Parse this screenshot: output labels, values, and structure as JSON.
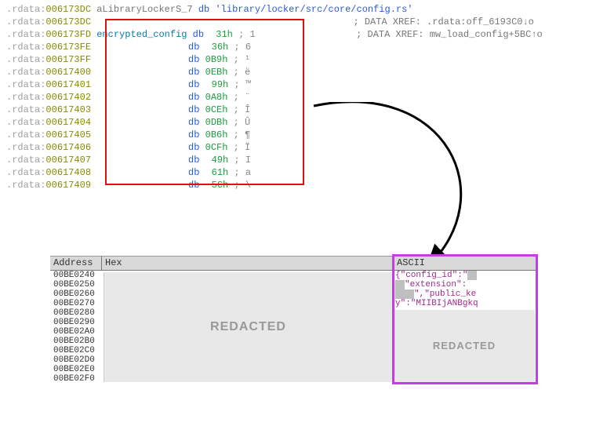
{
  "disasm": {
    "seg": ".rdata",
    "line_strdef": {
      "addr": "006173DC",
      "label": "aLibraryLockerS_7",
      "mnem": "db",
      "str": "'library/locker/src/core/config.rs'"
    },
    "line_xref1": {
      "addr": "006173DC",
      "cmt": "; DATA XREF: .rdata:off_6193C0↓o"
    },
    "line_enc": {
      "addr": "006173FD",
      "label": "encrypted_config",
      "mnem": "db",
      "val": "31h",
      "cmt": "; 1",
      "xref": "; DATA XREF: mw_load_config+5BC↑o"
    },
    "rows": [
      {
        "addr": "006173FE",
        "mnem": "db",
        "val": "36h",
        "cmt": "; 6"
      },
      {
        "addr": "006173FF",
        "mnem": "db",
        "val": "0B9h",
        "cmt": "; ¹"
      },
      {
        "addr": "00617400",
        "mnem": "db",
        "val": "0EBh",
        "cmt": "; ë"
      },
      {
        "addr": "00617401",
        "mnem": "db",
        "val": "99h",
        "cmt": "; ™"
      },
      {
        "addr": "00617402",
        "mnem": "db",
        "val": "0A8h",
        "cmt": "; ¨"
      },
      {
        "addr": "00617403",
        "mnem": "db",
        "val": "0CEh",
        "cmt": "; Î"
      },
      {
        "addr": "00617404",
        "mnem": "db",
        "val": "0DBh",
        "cmt": "; Û"
      },
      {
        "addr": "00617405",
        "mnem": "db",
        "val": "0B6h",
        "cmt": "; ¶"
      },
      {
        "addr": "00617406",
        "mnem": "db",
        "val": "0CFh",
        "cmt": "; Ï"
      },
      {
        "addr": "00617407",
        "mnem": "db",
        "val": "49h",
        "cmt": "; I"
      },
      {
        "addr": "00617408",
        "mnem": "db",
        "val": "61h",
        "cmt": "; a"
      },
      {
        "addr": "00617409",
        "mnem": "db",
        "val": "5Ch",
        "cmt": "; \\"
      }
    ]
  },
  "hex": {
    "headers": {
      "addr": "Address",
      "hex": "Hex",
      "ascii": "ASCII"
    },
    "addrs": [
      "00BE0240",
      "00BE0250",
      "00BE0260",
      "00BE0270",
      "00BE0280",
      "00BE0290",
      "00BE02A0",
      "00BE02B0",
      "00BE02C0",
      "00BE02D0",
      "00BE02E0",
      "00BE02F0"
    ],
    "redacted": "REDACTED",
    "ascii_top_1": "{\"config_id\":\"",
    "ascii_top_2": "\"extension\":",
    "ascii_top_3": "\",\"public_ke",
    "ascii_top_4": "y\":\"MIIBIjANBgkq"
  }
}
